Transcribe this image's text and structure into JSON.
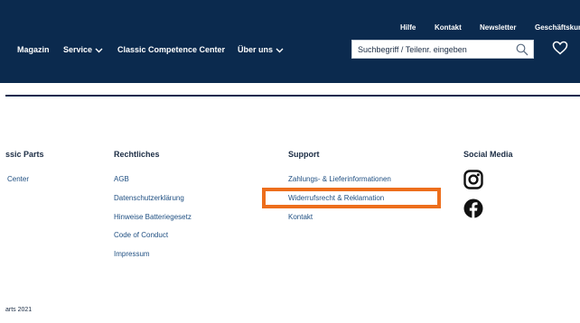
{
  "header": {
    "util_links": [
      "Hilfe",
      "Kontakt",
      "Newsletter",
      "Geschäftskun"
    ],
    "nav": [
      "Magazin",
      "Service",
      "Classic Competence Center",
      "Über uns"
    ],
    "search_placeholder": "Suchbegriff / Teilenr. eingeben"
  },
  "footer": {
    "columns": [
      {
        "heading": "ssic Parts",
        "links": [
          "Center"
        ]
      },
      {
        "heading": "Rechtliches",
        "links": [
          "AGB",
          "Datenschutzerklärung",
          "Hinweise Batteriegesetz",
          "Code of Conduct",
          "Impressum"
        ]
      },
      {
        "heading": "Support",
        "links": [
          "Zahlungs- & Lieferinformationen",
          "Widerrufsrecht & Reklamation",
          "Kontakt"
        ]
      },
      {
        "heading": "Social Media",
        "icons": [
          "instagram-icon",
          "facebook-icon"
        ]
      }
    ],
    "copyright": "arts 2021"
  },
  "colors": {
    "header_bg": "#0b2a4e",
    "highlight": "#ed6e1c",
    "link": "#1f4f82"
  }
}
